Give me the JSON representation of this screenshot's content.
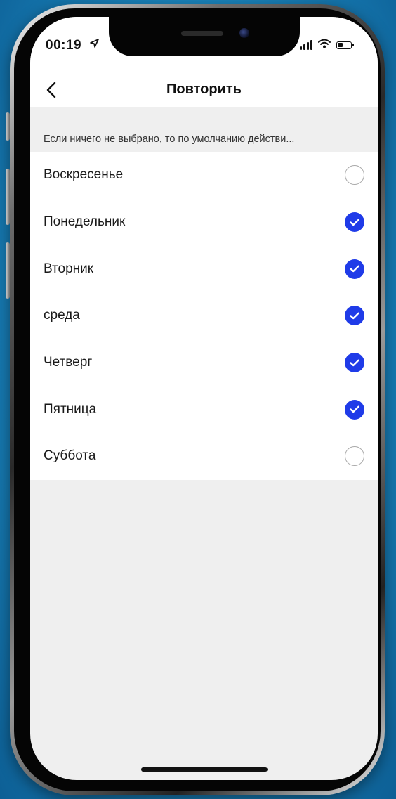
{
  "status_bar": {
    "time": "00:19",
    "icons": [
      "location-arrow-icon",
      "signal-icon",
      "wifi-icon",
      "battery-icon"
    ]
  },
  "header": {
    "title": "Повторить",
    "back_icon": "chevron-left-icon"
  },
  "hint": {
    "text": "Если ничего не выбрано, то по умолчанию действи..."
  },
  "days": [
    {
      "label": "Воскресенье",
      "checked": false
    },
    {
      "label": "Понедельник",
      "checked": true
    },
    {
      "label": "Вторник",
      "checked": true
    },
    {
      "label": "среда",
      "checked": true
    },
    {
      "label": "Четверг",
      "checked": true
    },
    {
      "label": "Пятница",
      "checked": true
    },
    {
      "label": "Суббота",
      "checked": false
    }
  ],
  "colors": {
    "accent": "#1f3be8",
    "background": "#efefef",
    "list_background": "#ffffff",
    "unchecked_border": "#a9a9a9"
  }
}
